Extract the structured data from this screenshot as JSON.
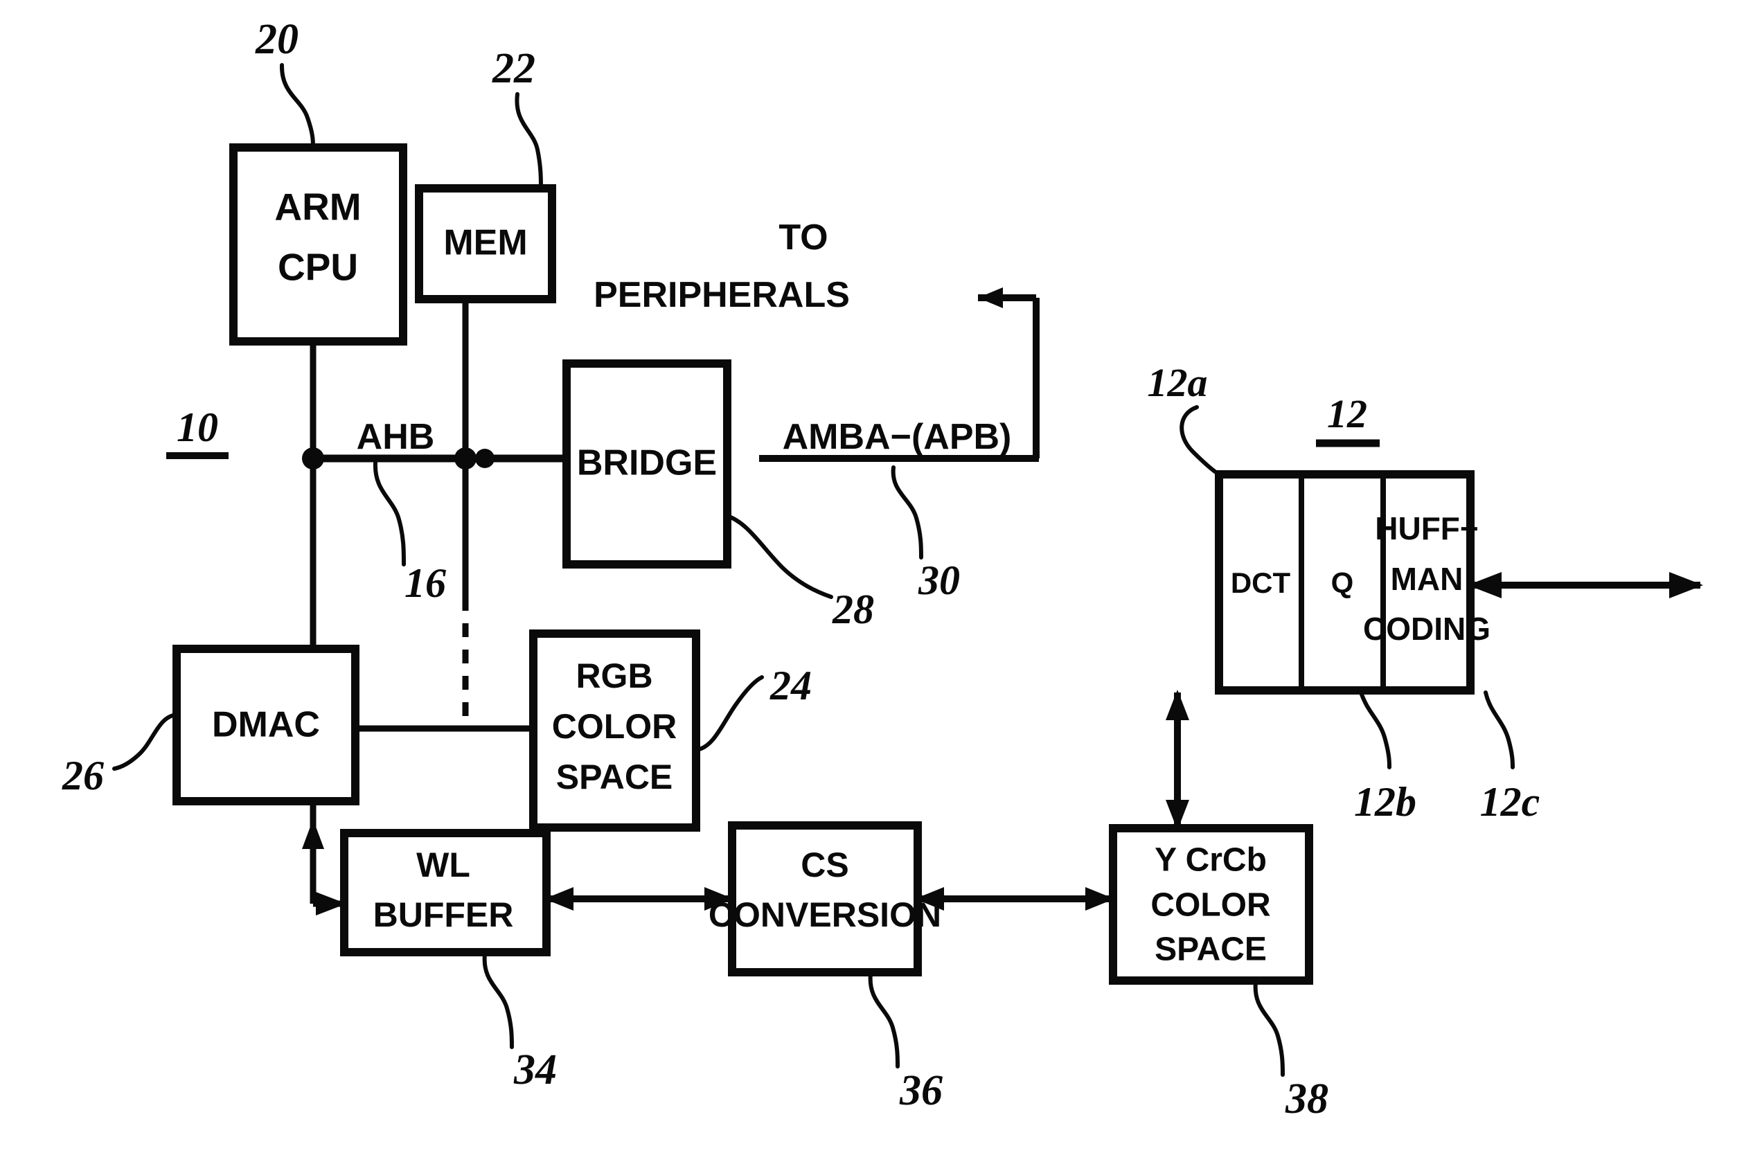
{
  "figure": {
    "type": "patent-block-diagram",
    "background_color": "#ffffff",
    "ink_color": "#0a0a0a"
  },
  "blocks": {
    "arm_cpu": {
      "line1": "ARM",
      "line2": "CPU"
    },
    "mem": {
      "line1": "MEM"
    },
    "bridge": {
      "line1": "BRIDGE"
    },
    "dmac": {
      "line1": "DMAC"
    },
    "rgb_cs": {
      "line1": "RGB",
      "line2": "COLOR",
      "line3": "SPACE"
    },
    "wl_buffer": {
      "line1": "WL",
      "line2": "BUFFER"
    },
    "cs_conv": {
      "line1": "CS",
      "line2": "CONVERSION"
    },
    "ycrcb_cs": {
      "line1": "Y CrCb",
      "line2": "COLOR",
      "line3": "SPACE"
    },
    "dct": {
      "line1": "DCT"
    },
    "q": {
      "line1": "Q"
    },
    "huffman": {
      "line1": "HUFF−",
      "line2": "MAN",
      "line3": "CODING"
    }
  },
  "bus_labels": {
    "ahb": "AHB",
    "apb": "AMBA−(APB)"
  },
  "annotations": {
    "to_peripherals_line1": "TO",
    "to_peripherals_line2": "PERIPHERALS"
  },
  "reference_numerals": {
    "system": "10",
    "codec": "12",
    "dct": "12a",
    "quant": "12b",
    "huffman": "12c",
    "ahb_bus": "16",
    "arm_cpu": "20",
    "mem": "22",
    "rgb_color_space": "24",
    "dmac": "26",
    "bridge": "28",
    "apb_bus": "30",
    "wl_buffer": "34",
    "cs_conversion": "36",
    "ycrcb_color_space": "38"
  }
}
